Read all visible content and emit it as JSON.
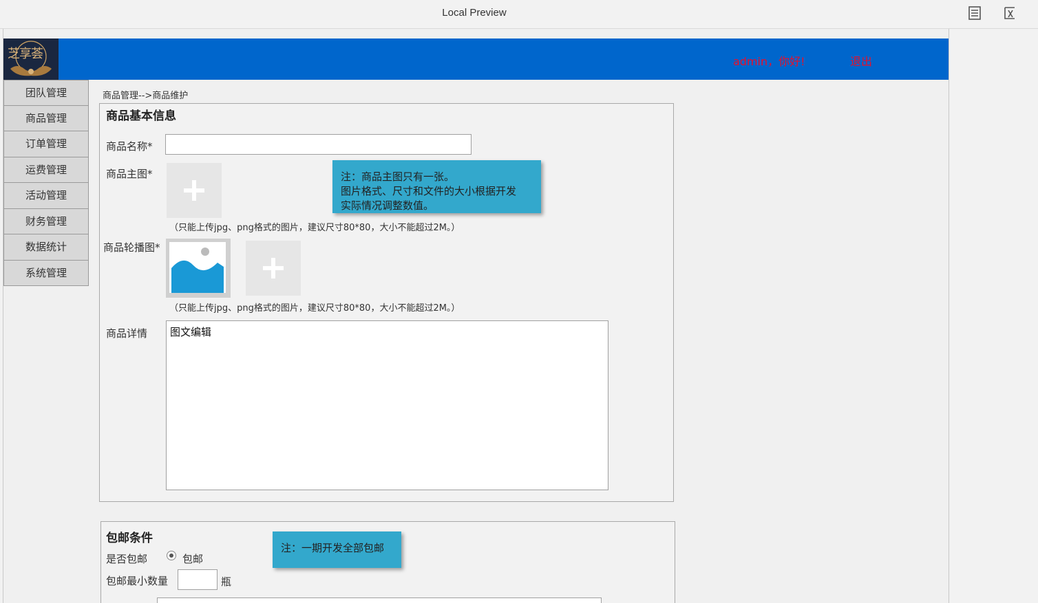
{
  "window": {
    "title": "Local Preview"
  },
  "header": {
    "logo_text": "芝享荟",
    "greeting": "admin，你好!",
    "logout": "退出",
    "accent": "#0066cc"
  },
  "sidebar": {
    "items": [
      {
        "label": "团队管理"
      },
      {
        "label": "商品管理"
      },
      {
        "label": "订单管理"
      },
      {
        "label": "运费管理"
      },
      {
        "label": "活动管理"
      },
      {
        "label": "财务管理"
      },
      {
        "label": "数据统计"
      },
      {
        "label": "系统管理"
      }
    ]
  },
  "breadcrumb": "商品管理-->商品维护",
  "basic_info": {
    "title": "商品基本信息",
    "name_label": "商品名称*",
    "name_value": "",
    "main_image_label": "商品主图*",
    "main_image_hint": "（只能上传jpg、png格式的图片，建议尺寸80*80，大小不能超过2M。）",
    "carousel_label": "商品轮播图*",
    "carousel_hint": "（只能上传jpg、png格式的图片，建议尺寸80*80，大小不能超过2M。）",
    "detail_label": "商品详情",
    "detail_placeholder": "图文编辑",
    "note_lines": [
      "注：商品主图只有一张。",
      "图片格式、尺寸和文件的大小根据开发",
      "实际情况调整数值。"
    ]
  },
  "shipping": {
    "title": "包邮条件",
    "free_label": "是否包邮",
    "free_option": "包邮",
    "min_qty_label": "包邮最小数量",
    "min_qty_value": "",
    "unit": "瓶",
    "note": "注：一期开发全部包邮"
  }
}
